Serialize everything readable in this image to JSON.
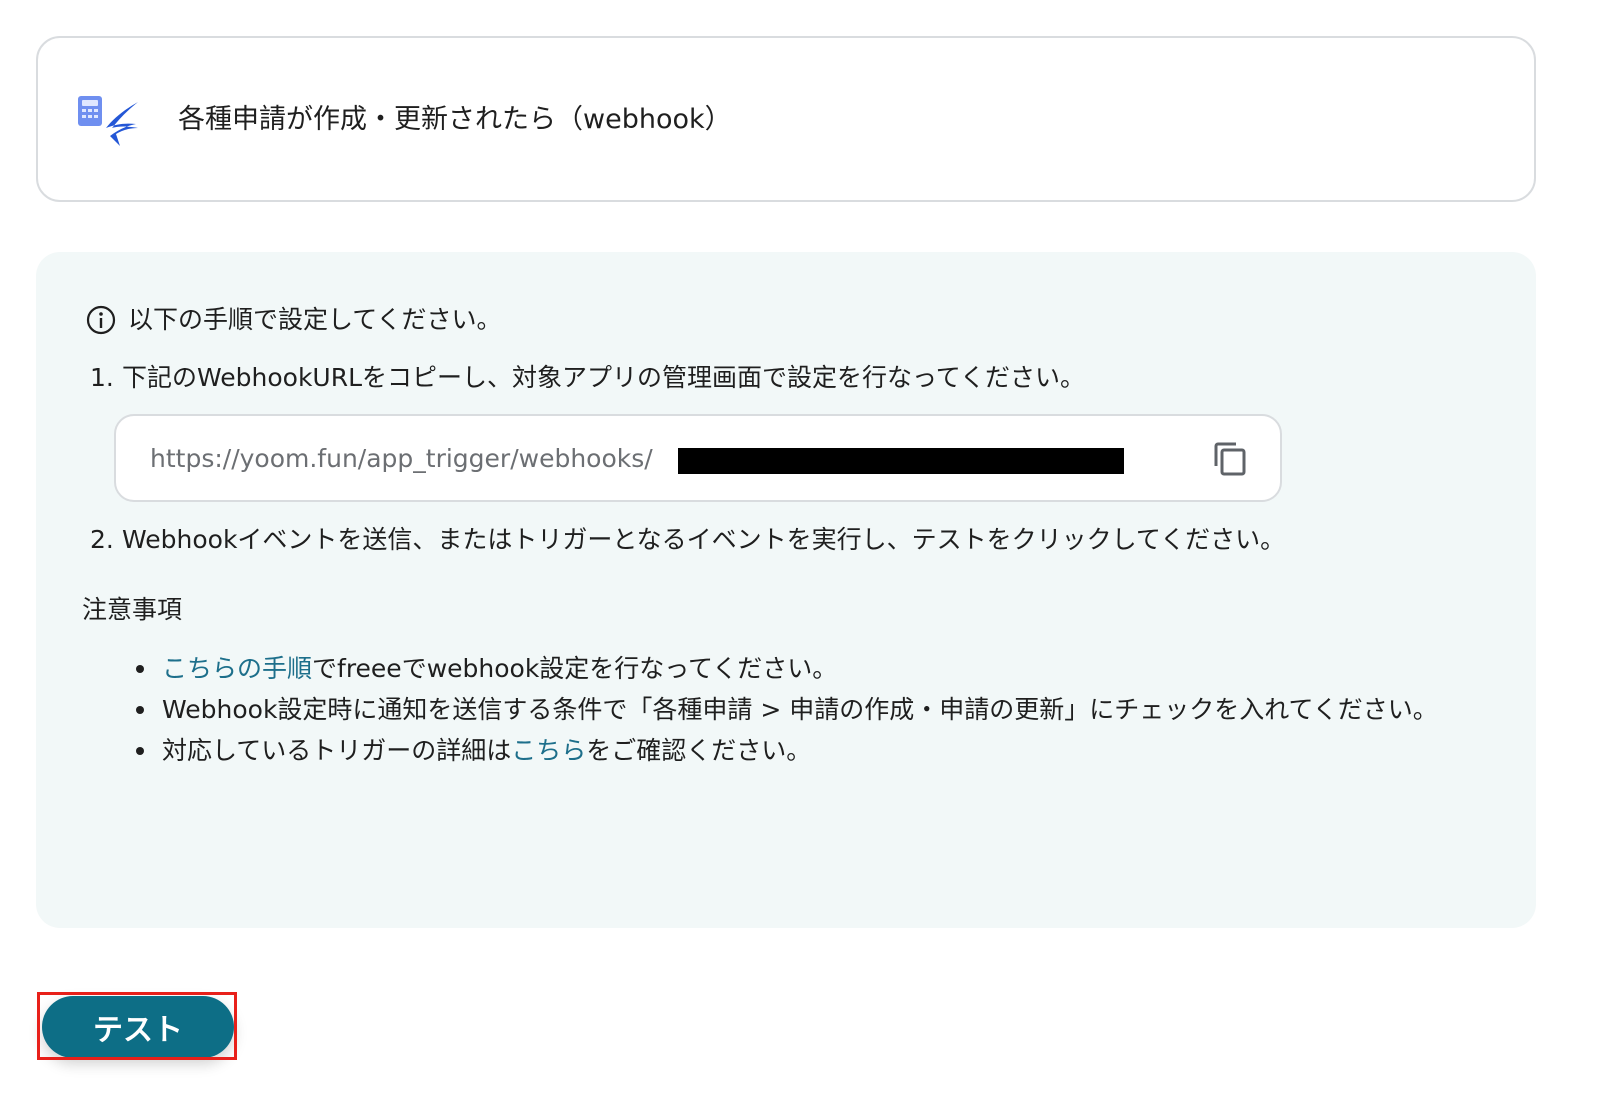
{
  "trigger": {
    "title": "各種申請が作成・更新されたら（webhook）",
    "icon": "freee-app-icon"
  },
  "instructions": {
    "heading": "以下の手順で設定してください。",
    "step1_number": "1.",
    "step1_text": "下記のWebhookURLをコピーし、対象アプリの管理画面で設定を行なってください。",
    "webhook_url": "https://yoom.fun/app_trigger/webhooks/",
    "copy_icon": "copy-icon",
    "step2_number": "2.",
    "step2_text": "Webhookイベントを送信、またはトリガーとなるイベントを実行し、テストをクリックしてください。"
  },
  "notes": {
    "heading": "注意事項",
    "item1_link": "こちらの手順",
    "item1_rest": "でfreeeでwebhook設定を行なってください。",
    "item2_text": "Webhook設定時に通知を送信する条件で「各種申請 > 申請の作成・申請の更新」にチェックを入れてください。",
    "item3_prefix": "対応しているトリガーの詳細は",
    "item3_link": "こちら",
    "item3_suffix": "をご確認ください。"
  },
  "actions": {
    "test_label": "テスト"
  },
  "colors": {
    "accent": "#0d6e86",
    "link": "#1d6f8b",
    "panel_bg": "#f2f8f8",
    "highlight": "#e8201a"
  }
}
